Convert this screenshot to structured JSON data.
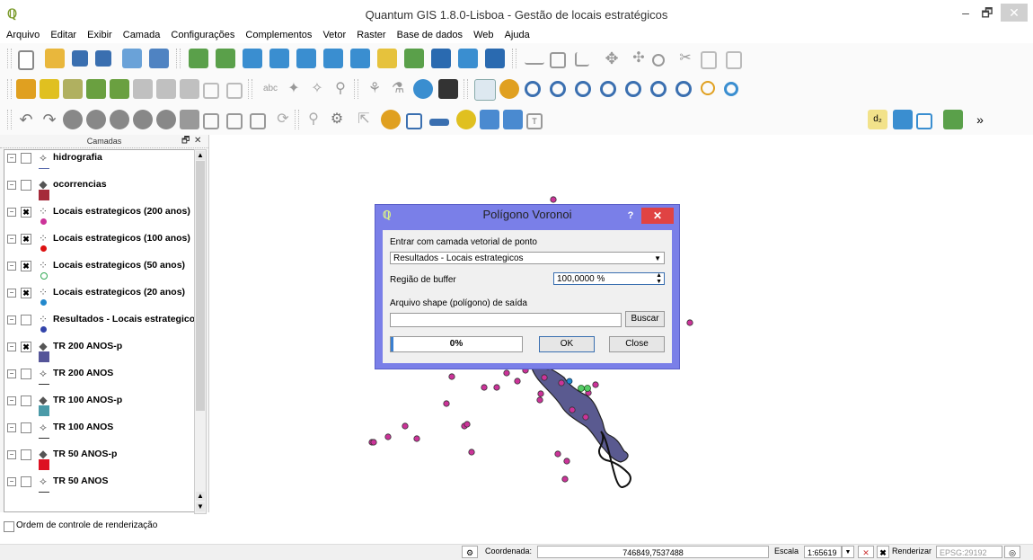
{
  "window": {
    "title": "Quantum GIS 1.8.0-Lisboa - Gestão de locais estratégicos",
    "minimize": "–",
    "restore": "🗗",
    "close": "✕"
  },
  "menu": [
    "Arquivo",
    "Editar",
    "Exibir",
    "Camada",
    "Configurações",
    "Complementos",
    "Vetor",
    "Raster",
    "Base de dados",
    "Web",
    "Ajuda"
  ],
  "layers_panel": {
    "title": "Camadas",
    "items": [
      {
        "name": "hidrografia",
        "checked": false,
        "type": "line-icon",
        "symbol_color": "#5566aa",
        "symbol": "line"
      },
      {
        "name": "ocorrencias",
        "checked": false,
        "type": "polygon-icon",
        "symbol_color": "#a52a3a",
        "symbol": "square"
      },
      {
        "name": "Locais estrategicos (200 anos)",
        "checked": true,
        "type": "points-icon",
        "symbol_color": "#cc3399",
        "symbol": "circle"
      },
      {
        "name": "Locais estrategicos (100 anos)",
        "checked": true,
        "type": "points-icon",
        "symbol_color": "#dd1111",
        "symbol": "circle"
      },
      {
        "name": "Locais estrategicos (50 anos)",
        "checked": true,
        "type": "points-icon",
        "symbol_color": "#33aa55",
        "symbol": "circle-outline"
      },
      {
        "name": "Locais estrategicos (20 anos)",
        "checked": true,
        "type": "points-icon",
        "symbol_color": "#2288cc",
        "symbol": "circle"
      },
      {
        "name": "Resultados - Locais estrategicos",
        "checked": false,
        "type": "points-icon",
        "symbol_color": "#3344aa",
        "symbol": "circle"
      },
      {
        "name": "TR 200 ANOS-p",
        "checked": true,
        "type": "polygon-icon",
        "symbol_color": "#555599",
        "symbol": "square"
      },
      {
        "name": "TR 200 ANOS",
        "checked": false,
        "type": "line-icon",
        "symbol_color": "#333333",
        "symbol": "line"
      },
      {
        "name": "TR 100 ANOS-p",
        "checked": false,
        "type": "polygon-icon",
        "symbol_color": "#4a9aa8",
        "symbol": "square"
      },
      {
        "name": "TR 100 ANOS",
        "checked": false,
        "type": "line-icon",
        "symbol_color": "#333333",
        "symbol": "line"
      },
      {
        "name": "TR 50 ANOS-p",
        "checked": false,
        "type": "polygon-icon",
        "symbol_color": "#dd1122",
        "symbol": "square"
      },
      {
        "name": "TR 50 ANOS",
        "checked": false,
        "type": "line-icon",
        "symbol_color": "#333333",
        "symbol": "line"
      }
    ],
    "render_order_label": "Ordem de controle de renderização"
  },
  "dialog": {
    "title": "Polígono Voronoi",
    "input_label": "Entrar com camada vetorial de ponto",
    "input_value": "Resultados - Locais estrategicos",
    "buffer_label": "Região de buffer",
    "buffer_value": "100,0000 %",
    "output_label": "Arquivo shape (polígono) de saída",
    "output_value": "",
    "browse_button": "Buscar",
    "progress": "0%",
    "progress_fraction": 0,
    "ok_button": "OK",
    "close_button": "Close",
    "help": "?",
    "x": "✕"
  },
  "status": {
    "coord_label": "Coordenada:",
    "coord_value": "746849,7537488",
    "scale_label": "Escala",
    "scale_value": "1:65619",
    "render_label": "Renderizar",
    "crs": "EPSG:29192"
  },
  "colors": {
    "point": "#cc3399",
    "river": "#5a5a90",
    "dialog_frame": "#7a7fe8"
  }
}
